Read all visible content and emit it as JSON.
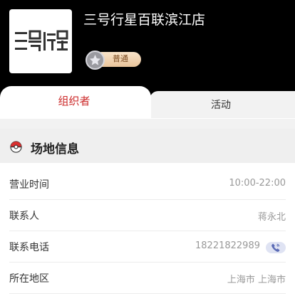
{
  "store": {
    "name": "三号行星百联滨江店",
    "logo_text": "三号行星",
    "level_label": "普通"
  },
  "tabs": [
    {
      "label": "组织者",
      "active": true
    },
    {
      "label": "活动",
      "active": false
    }
  ],
  "section": {
    "title": "场地信息",
    "icon": "pokeball-icon"
  },
  "info_rows": [
    {
      "label": "营业时间",
      "value": "10:00-22:00"
    },
    {
      "label": "联系人",
      "value": "蒋永北"
    },
    {
      "label": "联系电话",
      "value": "18221822989"
    },
    {
      "label": "所在地区",
      "value": "上海市 上海市"
    }
  ],
  "colors": {
    "header_bg": "#000000",
    "active_tab_text": "#cc2a2a",
    "badge_gold": "#e9c49b",
    "phone_button": "#dfe3f3"
  },
  "icons": {
    "badge": "star-icon",
    "phone": "phone-icon"
  }
}
